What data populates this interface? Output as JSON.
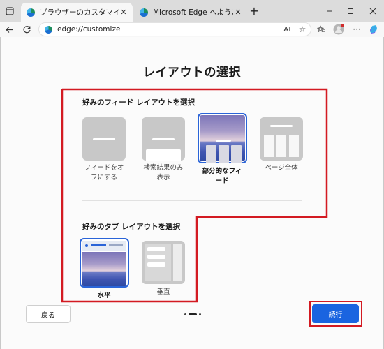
{
  "browser": {
    "tabs": [
      {
        "title": "ブラウザーのカスタマイズ",
        "active": true
      },
      {
        "title": "Microsoft Edge へようこそ",
        "active": false
      }
    ],
    "new_tab_icon": "plus-icon",
    "address": "edge://customize"
  },
  "page": {
    "title": "レイアウトの選択",
    "feed_section": {
      "title": "好みのフィード レイアウトを選択",
      "options": [
        {
          "label": "フィードをオフにする",
          "label_lines": [
            "フィードをオ",
            "フにする"
          ],
          "selected": false
        },
        {
          "label": "検索結果のみ表示",
          "label_lines": [
            "検索結果のみ",
            "表示"
          ],
          "selected": false
        },
        {
          "label": "部分的なフィード",
          "label_lines": [
            "部分的なフィ",
            "ード"
          ],
          "selected": true
        },
        {
          "label": "ページ全体",
          "label_lines": [
            "ページ全体"
          ],
          "selected": false
        }
      ]
    },
    "tab_section": {
      "title": "好みのタブ レイアウトを選択",
      "options": [
        {
          "label": "水平",
          "selected": true
        },
        {
          "label": "垂直",
          "selected": false
        }
      ]
    },
    "back_label": "戻る",
    "next_label": "続行",
    "pagination": {
      "total": 3,
      "current": 2
    }
  },
  "colors": {
    "accent": "#1a64e0",
    "highlight": "#d31a22",
    "selected_border": "#2a64d8"
  }
}
